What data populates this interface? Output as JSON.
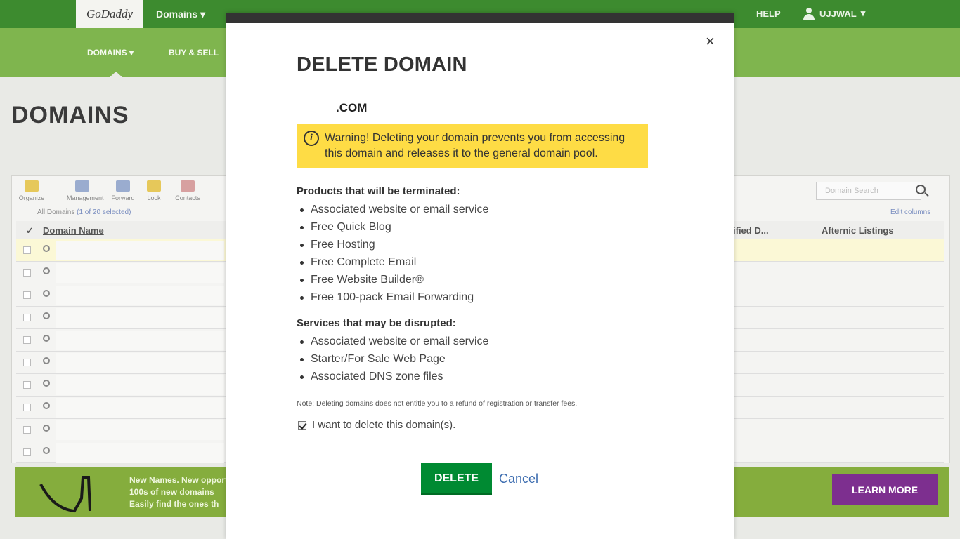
{
  "header": {
    "logo": "GoDaddy",
    "menu": "Domains",
    "help": "HELP",
    "user": "UJJWAL"
  },
  "subnav": {
    "items": [
      "DOMAINS",
      "BUY & SELL"
    ]
  },
  "page": {
    "title": "DOMAINS"
  },
  "toolbar": {
    "tools": [
      "Organize",
      "Management",
      "Forward",
      "Lock",
      "Contacts"
    ],
    "search_placeholder": "Domain Search"
  },
  "table": {
    "filter_text": "All Domains",
    "selection_text": "(1 of 20 selected)",
    "edit_columns": "Edit columns",
    "columns": [
      "Domain Name",
      "ified D...",
      "Afternic Listings"
    ]
  },
  "banner": {
    "lines": [
      "New Names. New opportunities.",
      "100s of new domains",
      "Easily find the ones th"
    ],
    "cta": "LEARN MORE"
  },
  "modal": {
    "close_symbol": "×",
    "title": "DELETE DOMAIN",
    "domain": ".COM",
    "warning": "Warning! Deleting your domain prevents you from accessing this domain and releases it to the general domain pool.",
    "products_heading": "Products that will be terminated:",
    "products": [
      "Associated website or email service",
      "Free Quick Blog",
      "Free Hosting",
      "Free Complete Email",
      "Free Website Builder®",
      "Free 100-pack Email Forwarding"
    ],
    "services_heading": "Services that may be disrupted:",
    "services": [
      "Associated website or email service",
      "Starter/For Sale Web Page",
      "Associated DNS zone files"
    ],
    "note": "Note: Deleting domains does not entitle you to a refund of registration or transfer fees.",
    "confirm_label": "I want to delete this domain(s).",
    "delete_label": "DELETE",
    "cancel_label": "Cancel"
  }
}
